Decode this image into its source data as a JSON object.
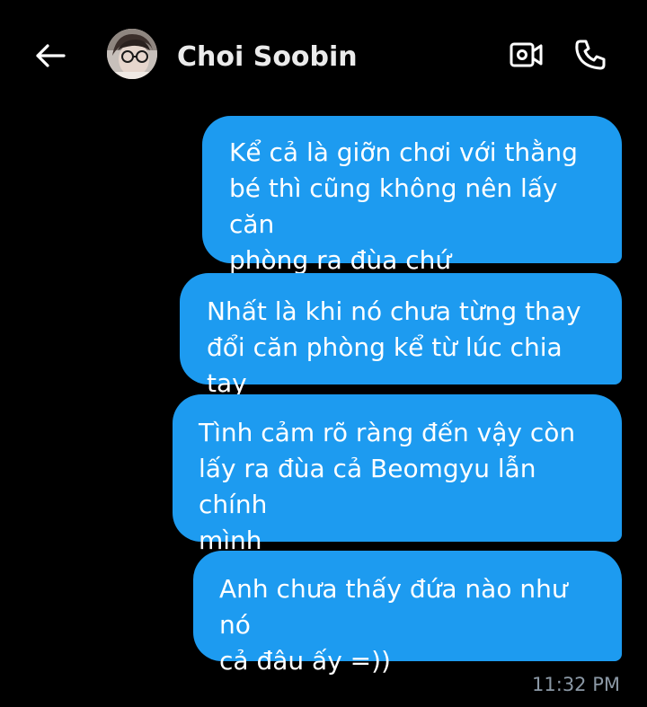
{
  "header": {
    "back_icon": "arrow-left-icon",
    "contact_name": "Choi Soobin",
    "video_icon": "video-camera-icon",
    "call_icon": "phone-icon"
  },
  "messages": [
    {
      "text": "Kể cả là giỡn chơi với thằng\nbé thì cũng không nên lấy căn\nphòng ra đùa chứ",
      "sender": "me"
    },
    {
      "text": "Nhất là khi nó chưa từng thay\nđổi căn phòng kể từ lúc chia tay",
      "sender": "me"
    },
    {
      "text": "Tình cảm rõ ràng đến vậy còn\nlấy ra đùa cả Beomgyu lẫn chính\nmình",
      "sender": "me"
    },
    {
      "text": "Anh chưa thấy đứa nào như nó\ncả đâu ấy =))",
      "sender": "me"
    }
  ],
  "last_timestamp": "11:32 PM",
  "colors": {
    "background": "#000000",
    "bubble": "#1d9bf0",
    "bubble_text": "#ffffff",
    "timestamp": "#8b98a5",
    "header_text": "#ebebeb"
  }
}
